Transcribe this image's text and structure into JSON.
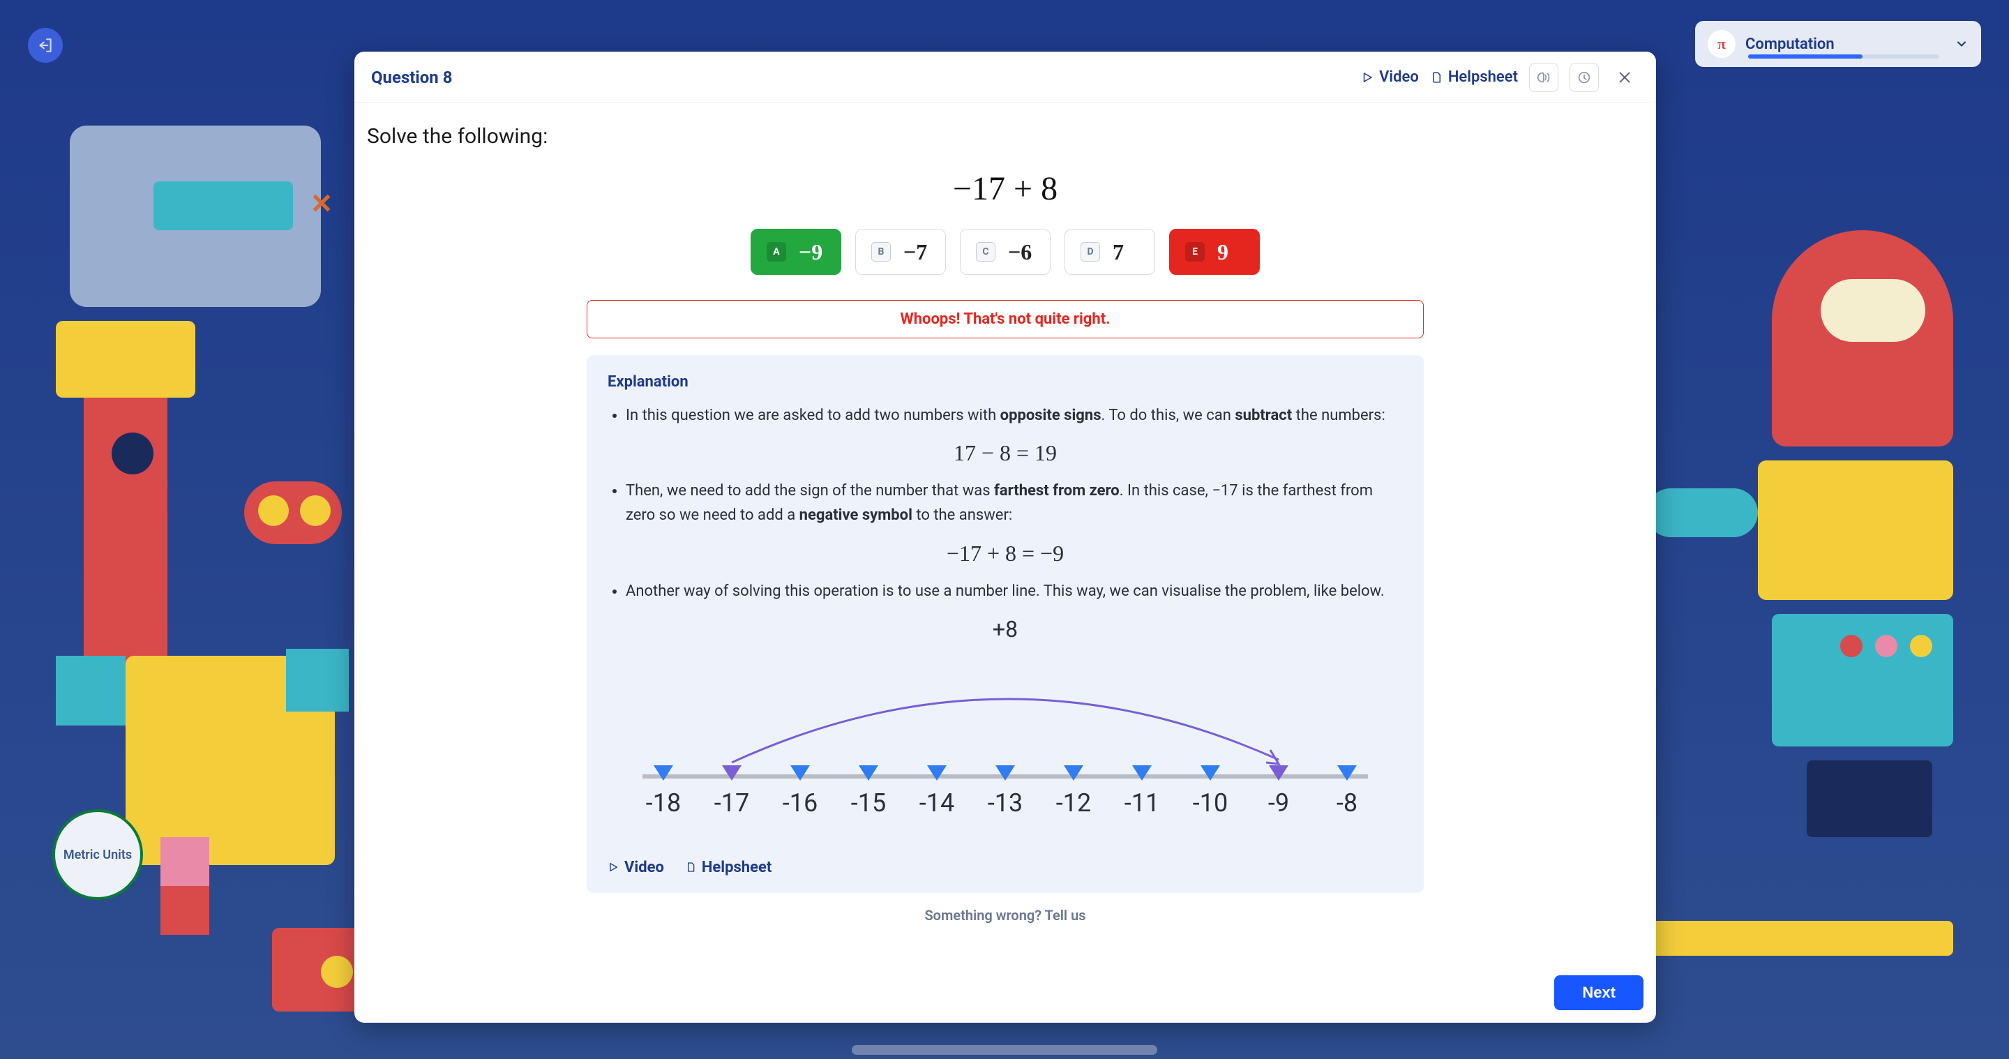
{
  "topbar": {
    "exit_label": "exit",
    "pill_label": "Computation",
    "pill_progress_pct": 60
  },
  "metric_circle": "Metric Units",
  "question": {
    "title": "Question 8",
    "prompt": "Solve the following:",
    "expression": "−17 + 8",
    "choices": [
      {
        "letter": "A",
        "value": "−9",
        "state": "correct"
      },
      {
        "letter": "B",
        "value": "−7",
        "state": "neutral"
      },
      {
        "letter": "C",
        "value": "−6",
        "state": "neutral"
      },
      {
        "letter": "D",
        "value": "7",
        "state": "neutral"
      },
      {
        "letter": "E",
        "value": "9",
        "state": "wrong"
      }
    ],
    "feedback": "Whoops! That's not quite right."
  },
  "header_links": {
    "video": "Video",
    "helpsheet": "Helpsheet"
  },
  "explanation": {
    "title": "Explanation",
    "p1_a": "In this question we are asked to add two numbers with ",
    "p1_b": "opposite signs",
    "p1_c": ". To do this, we can ",
    "p1_d": "subtract",
    "p1_e": " the numbers:",
    "eq1": "17 − 8 = 19",
    "p2_a": "Then, we need to add the sign of the number that was ",
    "p2_b": "farthest from zero",
    "p2_c": ". In this case, −17 is the farthest from zero so we need to add a ",
    "p2_d": "negative symbol",
    "p2_e": " to the answer:",
    "eq2": "−17 + 8 = −9",
    "p3": "Another way of solving this operation is to use a number line. This way, we can visualise the problem, like below.",
    "arc_label": "+8",
    "number_line": [
      "-18",
      "-17",
      "-16",
      "-15",
      "-14",
      "-13",
      "-12",
      "-11",
      "-10",
      "-9",
      "-8"
    ],
    "start_index": 1,
    "end_index": 9,
    "links": {
      "video": "Video",
      "helpsheet": "Helpsheet"
    }
  },
  "footer": {
    "report": "Something wrong? Tell us",
    "next": "Next"
  }
}
